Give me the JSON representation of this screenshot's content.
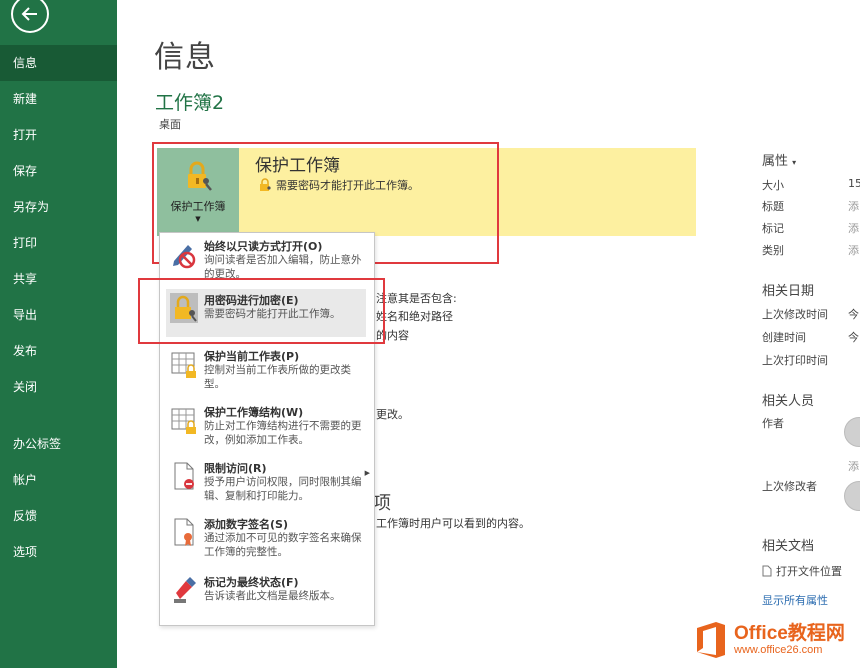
{
  "sidebar": {
    "items": [
      {
        "label": "信息",
        "active": true
      },
      {
        "label": "新建"
      },
      {
        "label": "打开"
      },
      {
        "label": "保存"
      },
      {
        "label": "另存为"
      },
      {
        "label": "打印"
      },
      {
        "label": "共享"
      },
      {
        "label": "导出"
      },
      {
        "label": "发布"
      },
      {
        "label": "关闭"
      },
      {
        "label": "办公标签"
      },
      {
        "label": "帐户"
      },
      {
        "label": "反馈"
      },
      {
        "label": "选项"
      }
    ]
  },
  "main": {
    "title": "信息",
    "workbook_name": "工作簿2",
    "workbook_location": "桌面",
    "protect": {
      "button_label": "保护工作簿",
      "title": "保护工作簿",
      "description": "需要密码才能打开此工作簿。"
    },
    "background_text": {
      "line1": "注意其是否包含:",
      "line2": "姓名和绝对路径",
      "line3": "的内容",
      "line4": "更改。",
      "line5": "项",
      "line6": "工作簿时用户可以看到的内容。"
    }
  },
  "dropdown": {
    "items": [
      {
        "title": "始终以只读方式打开(O)",
        "desc": "询问读者是否加入编辑，防止意外的更改。",
        "icon": "pencil-no-icon"
      },
      {
        "title": "用密码进行加密(E)",
        "desc": "需要密码才能打开此工作簿。",
        "icon": "lock-key-icon"
      },
      {
        "title": "保护当前工作表(P)",
        "desc": "控制对当前工作表所做的更改类型。",
        "icon": "sheet-lock-icon"
      },
      {
        "title": "保护工作簿结构(W)",
        "desc": "防止对工作簿结构进行不需要的更改，例如添加工作表。",
        "icon": "structure-lock-icon"
      },
      {
        "title": "限制访问(R)",
        "desc": "授予用户访问权限，同时限制其编辑、复制和打印能力。",
        "icon": "document-restrict-icon"
      },
      {
        "title": "添加数字签名(S)",
        "desc": "通过添加不可见的数字签名来确保工作簿的完整性。",
        "icon": "document-signature-icon"
      },
      {
        "title": "标记为最终状态(F)",
        "desc": "告诉读者此文档是最终版本。",
        "icon": "final-stamp-icon"
      }
    ]
  },
  "right": {
    "properties_header": "属性",
    "props": [
      {
        "label": "大小",
        "value": "15"
      },
      {
        "label": "标题",
        "value": "添"
      },
      {
        "label": "标记",
        "value": "添"
      },
      {
        "label": "类别",
        "value": "添"
      }
    ],
    "dates_header": "相关日期",
    "dates": [
      {
        "label": "上次修改时间",
        "value": "今"
      },
      {
        "label": "创建时间",
        "value": "今"
      },
      {
        "label": "上次打印时间",
        "value": ""
      }
    ],
    "people_header": "相关人员",
    "author_label": "作者",
    "add_author": "添",
    "last_modified_by_label": "上次修改者",
    "documents_header": "相关文档",
    "open_location": "打开文件位置",
    "show_all_props": "显示所有属性"
  },
  "watermark": {
    "line1": "Office教程网",
    "line2": "www.office26.com"
  },
  "colors": {
    "sidebar_bg": "#217346",
    "sidebar_active": "#185a35",
    "protect_band": "#fdf0a0",
    "protect_button": "#8fbf9e",
    "highlight_frame": "#e0393e",
    "watermark": "#e8641d"
  }
}
